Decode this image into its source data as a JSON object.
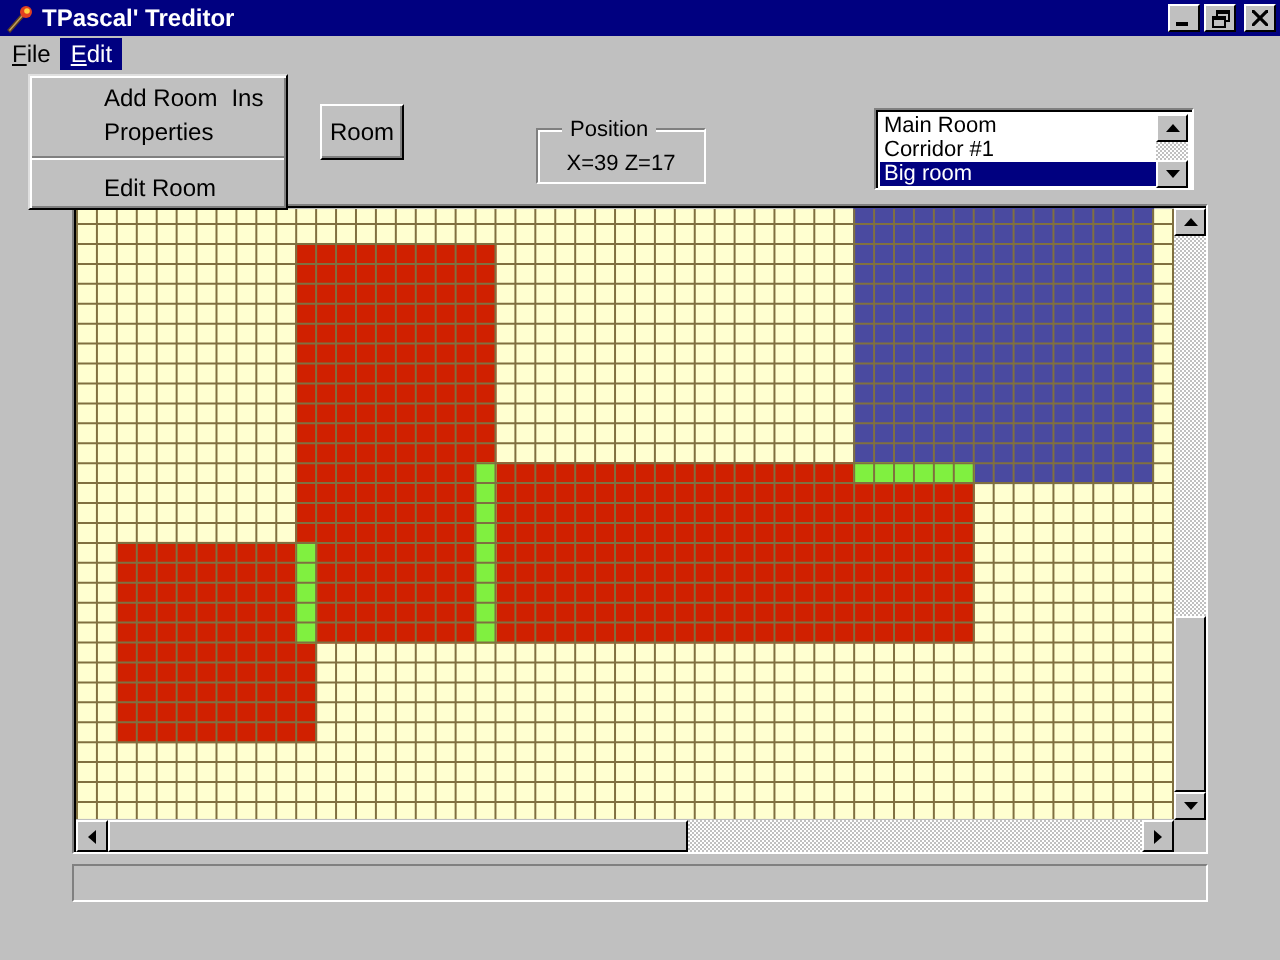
{
  "window": {
    "title": "TPascal' Treditor"
  },
  "menu": [
    {
      "label": "File",
      "selected": false
    },
    {
      "label": "Edit",
      "selected": true
    }
  ],
  "edit_menu": [
    {
      "label": "Add Room",
      "shortcut": "Ins",
      "kind": "item"
    },
    {
      "label": "Properties",
      "kind": "item"
    },
    {
      "kind": "separator"
    },
    {
      "label": "Edit Room",
      "kind": "item"
    }
  ],
  "toolbar": {
    "button": "Room",
    "position": {
      "title": "Position",
      "value": "X=39  Z=17"
    }
  },
  "rooms": [
    {
      "label": "Main Room",
      "selected": false
    },
    {
      "label": "Corridor #1",
      "selected": false
    },
    {
      "label": "Big room",
      "selected": true
    }
  ]
}
